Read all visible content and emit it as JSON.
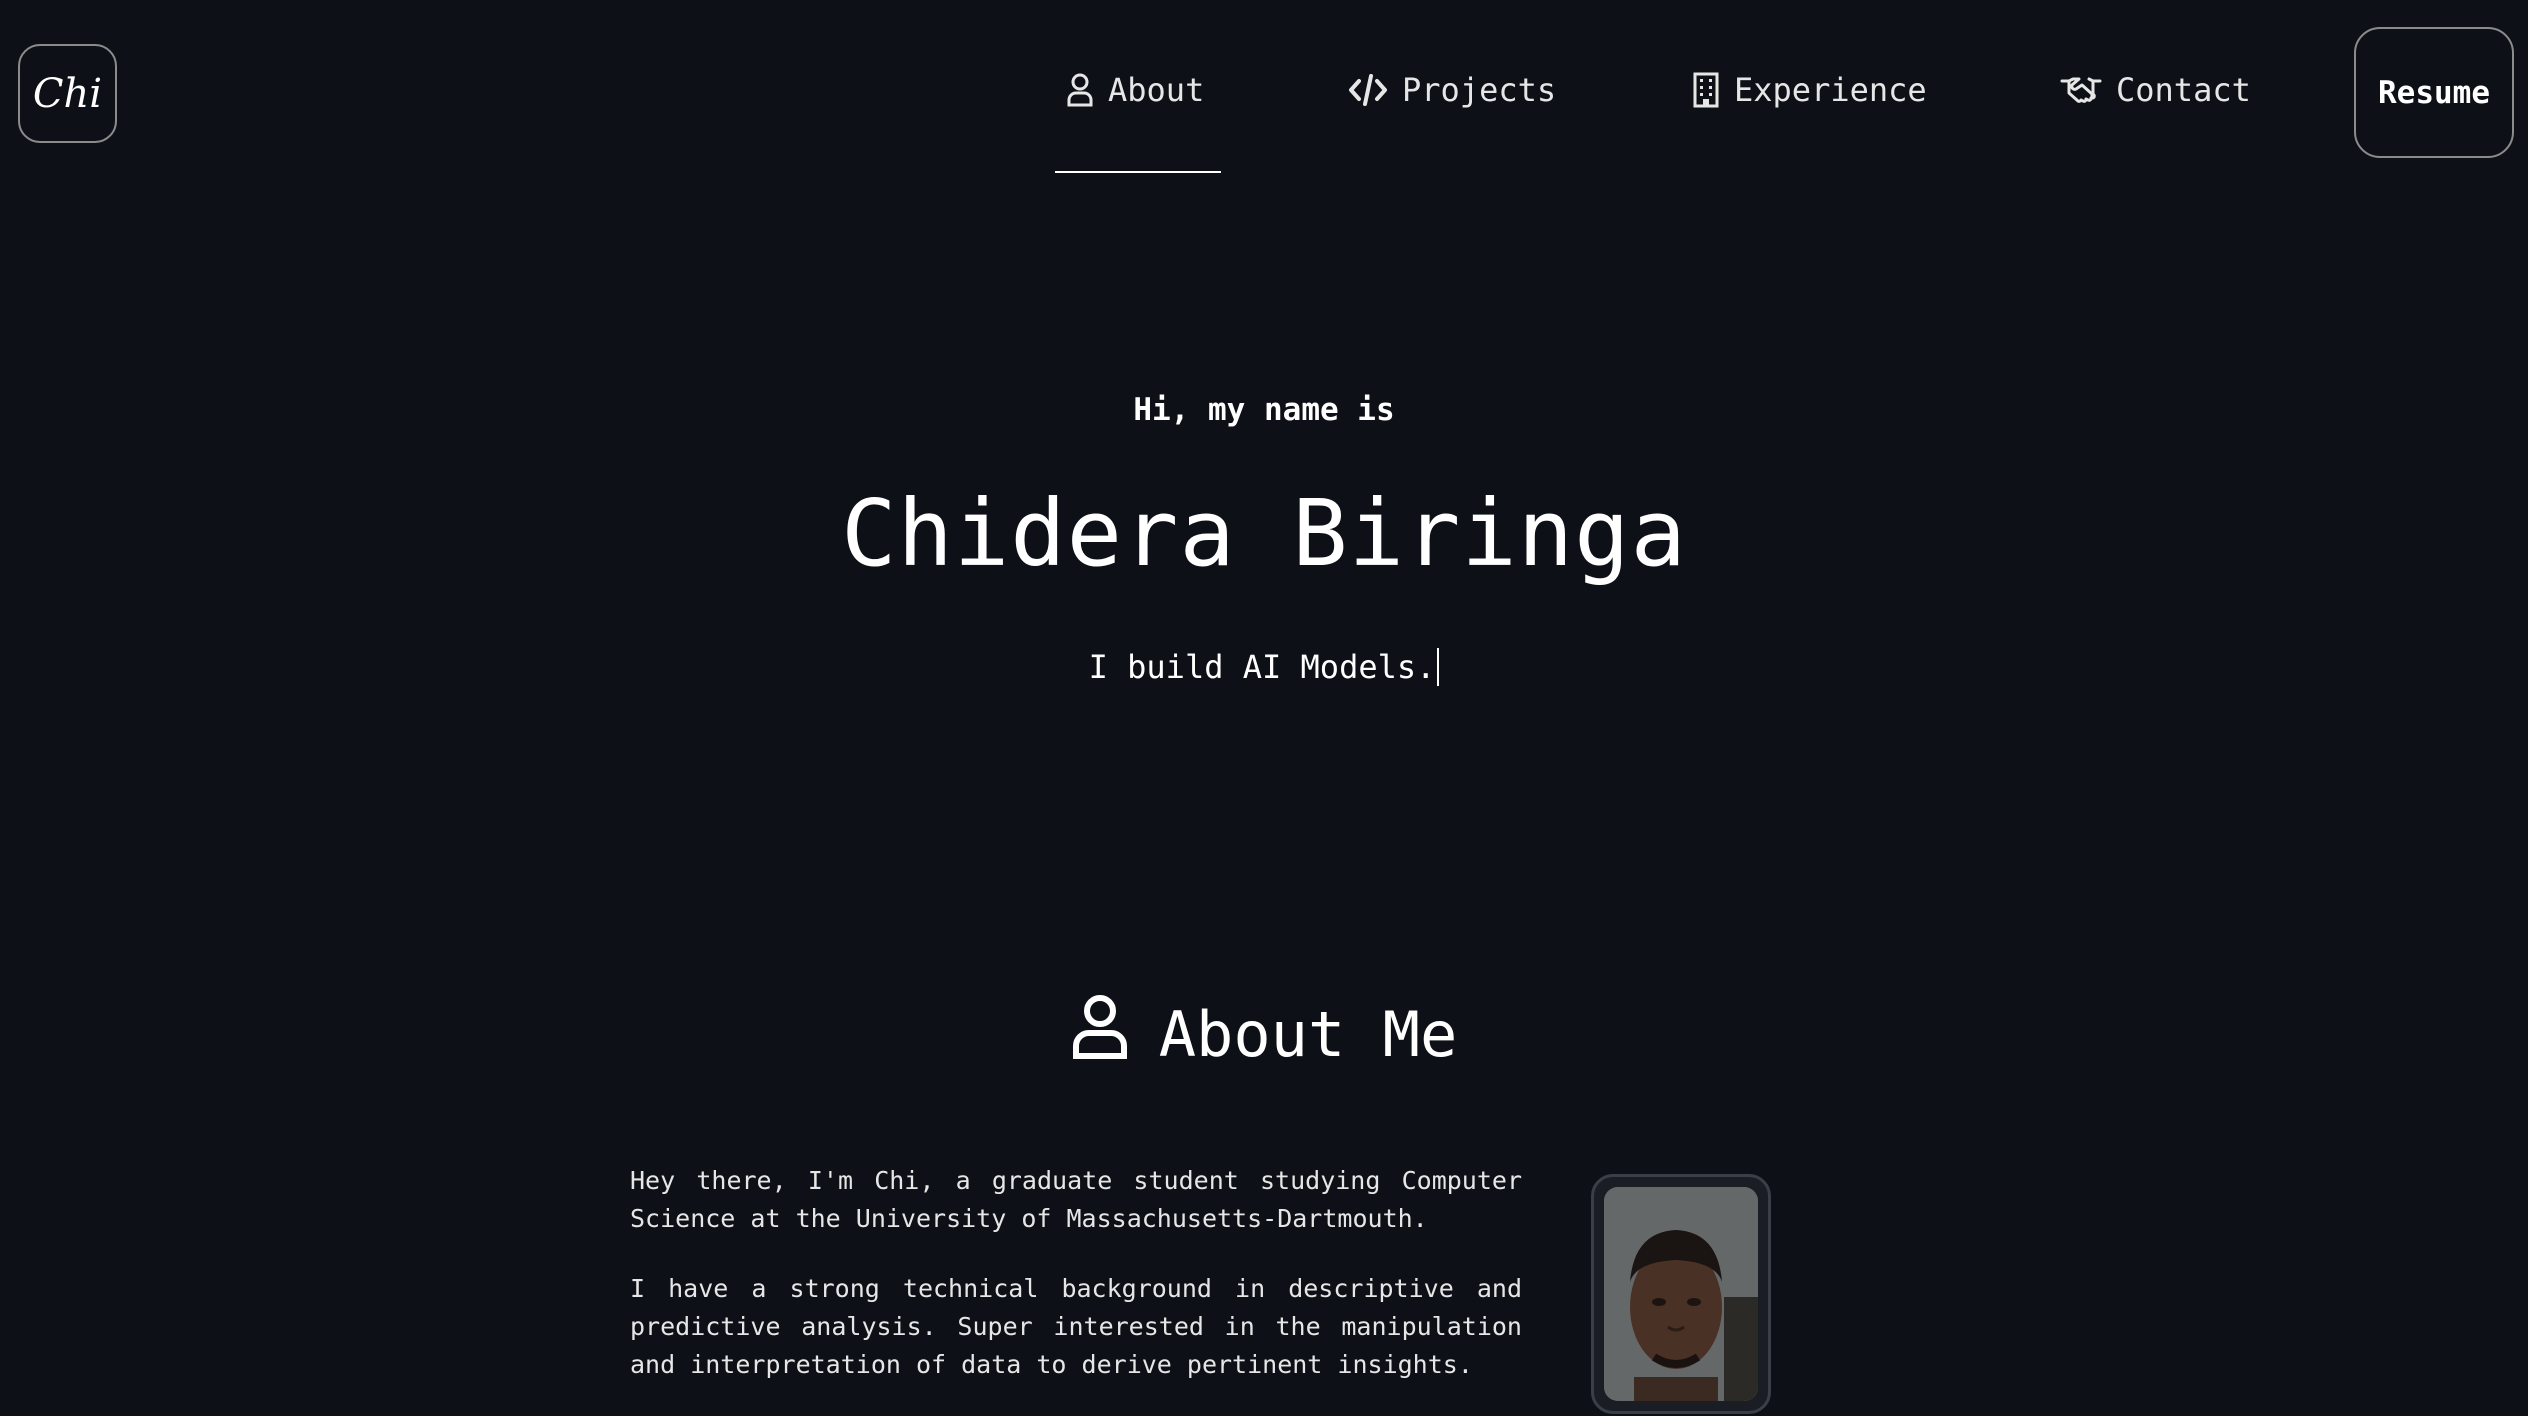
{
  "logo": {
    "text": "Chi"
  },
  "nav": {
    "items": [
      {
        "label": "About",
        "icon": "person-icon",
        "active": true
      },
      {
        "label": "Projects",
        "icon": "code-icon"
      },
      {
        "label": "Experience",
        "icon": "building-icon"
      },
      {
        "label": "Contact",
        "icon": "handshake-icon"
      }
    ],
    "resume_label": "Resume"
  },
  "hero": {
    "greeting": "Hi, my name is",
    "name": "Chidera Biringa",
    "tagline": "I build AI Models."
  },
  "about": {
    "heading": "About Me",
    "heading_icon": "person-icon",
    "paragraphs": [
      "Hey there, I'm Chi, a graduate student studying Computer Science at the University of Massachusetts-Dartmouth.",
      "I have a strong technical background in descriptive and predictive analysis. Super interested in the manipulation and interpretation of data to derive pertinent insights."
    ]
  },
  "colors": {
    "background": "#0d1117",
    "text": "#ffffff",
    "border": "#8b8b8b"
  }
}
